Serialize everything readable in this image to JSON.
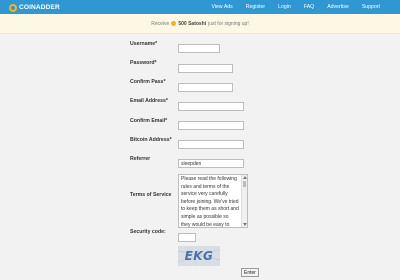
{
  "brand": {
    "name": "COINADDER"
  },
  "nav": {
    "items": [
      {
        "label": "View Ads"
      },
      {
        "label": "Register"
      },
      {
        "label": "Login"
      },
      {
        "label": "FAQ"
      },
      {
        "label": "Advertise"
      },
      {
        "label": "Support"
      }
    ]
  },
  "banner": {
    "prefix": "Receive",
    "amount": "500 Satoshi",
    "suffix": "just for signing up!"
  },
  "form": {
    "username_label": "Username*",
    "password_label": "Password*",
    "confirm_pass_label": "Confirm Pass*",
    "email_label": "Email Address*",
    "confirm_email_label": "Confirm Email*",
    "bitcoin_label": "Bitcoin Address*",
    "referrer_label": "Referrer",
    "referrer_value": "sleepden",
    "terms_label": "Terms of Service",
    "terms_text": "Please read the following rules and terms of the service very carefully before joining. We've tried to keep them as short and simple as possible so they would be easy to",
    "security_label": "Security code:",
    "captcha_text": "EKG",
    "submit_label": "Enter"
  },
  "colors": {
    "navbar": "#2f98d3",
    "banner_bg": "#fdf8e4",
    "coin": "#f0b020"
  }
}
